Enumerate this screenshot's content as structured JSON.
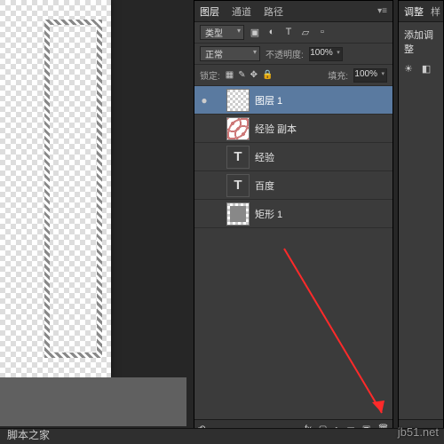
{
  "tabs": {
    "layers": "图层",
    "channels": "通道",
    "paths": "路径"
  },
  "filter": {
    "kind": "类型"
  },
  "blend": {
    "mode": "正常",
    "opacity_label": "不透明度:",
    "opacity": "100%"
  },
  "lock": {
    "label": "锁定:",
    "fill_label": "填充:",
    "fill": "100%"
  },
  "layers": [
    {
      "name": "图层 1",
      "type": "pixel",
      "selected": true,
      "visible": true
    },
    {
      "name": "经验 副本",
      "type": "pattern",
      "selected": false,
      "visible": false
    },
    {
      "name": "经验",
      "type": "type",
      "selected": false,
      "visible": false
    },
    {
      "name": "百度",
      "type": "type",
      "selected": false,
      "visible": false
    },
    {
      "name": "矩形 1",
      "type": "shape",
      "selected": false,
      "visible": false
    }
  ],
  "adjustments": {
    "tab": "调整",
    "partial_tab": "样",
    "label": "添加调整"
  },
  "icons": {
    "eye": "●",
    "image": "▣",
    "mask": "▢",
    "text": "T",
    "shape": "▱",
    "smart": "▫",
    "fx": "fx",
    "circle": "●",
    "halfcircle": "◐",
    "folder": "▭",
    "new": "▣",
    "trash": "🗑",
    "link": "⟲",
    "lock": "🔒",
    "brush": "✎",
    "transparency": "▦",
    "move": "✥",
    "bright": "☀",
    "contrast": "◧"
  },
  "watermark": "jb51.net",
  "brand": "脚本之家"
}
